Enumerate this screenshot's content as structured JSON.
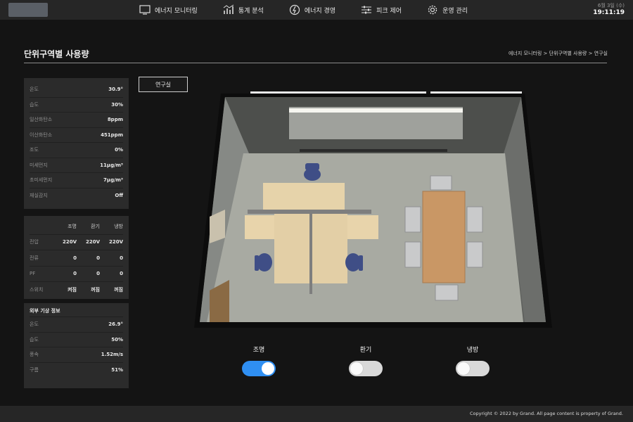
{
  "nav": {
    "items": [
      {
        "label": "에너지 모니터링",
        "icon": "monitor-icon"
      },
      {
        "label": "통계 분석",
        "icon": "chart-icon"
      },
      {
        "label": "에너지 경영",
        "icon": "energy-icon"
      },
      {
        "label": "피크 제어",
        "icon": "sliders-icon"
      },
      {
        "label": "운영 관리",
        "icon": "gear-icon"
      }
    ]
  },
  "clock": {
    "date": "6월 3일 (수)",
    "time": "19:11:19"
  },
  "page": {
    "title": "단위구역별 사용량",
    "breadcrumb": "에너지 모니터링 > 단위구역별 사용량 > 연구실"
  },
  "room_button": "연구실",
  "env": [
    {
      "key": "온도",
      "value": "30.9°"
    },
    {
      "key": "습도",
      "value": "30%"
    },
    {
      "key": "일산화탄소",
      "value": "8ppm"
    },
    {
      "key": "이산화탄소",
      "value": "451ppm"
    },
    {
      "key": "조도",
      "value": "0%"
    },
    {
      "key": "미세먼지",
      "value": "11μg/m³"
    },
    {
      "key": "초미세먼지",
      "value": "7μg/m³"
    },
    {
      "key": "재실감지",
      "value": "Off"
    }
  ],
  "power": {
    "headers": [
      "조명",
      "환기",
      "냉방"
    ],
    "rows": [
      {
        "key": "전압",
        "values": [
          "220V",
          "220V",
          "220V"
        ]
      },
      {
        "key": "전류",
        "values": [
          "0",
          "0",
          "0"
        ]
      },
      {
        "key": "PF",
        "values": [
          "0",
          "0",
          "0"
        ]
      },
      {
        "key": "스위치",
        "values": [
          "켜짐",
          "꺼짐",
          "꺼짐"
        ]
      }
    ]
  },
  "weather": {
    "title": "외부 기상 정보",
    "rows": [
      {
        "key": "온도",
        "value": "26.9°"
      },
      {
        "key": "습도",
        "value": "50%"
      },
      {
        "key": "풍속",
        "value": "1.52m/s"
      },
      {
        "key": "구름",
        "value": "51%"
      }
    ]
  },
  "controls": [
    {
      "label": "조명",
      "state": "on"
    },
    {
      "label": "환기",
      "state": "off"
    },
    {
      "label": "냉방",
      "state": "off"
    }
  ],
  "colors": {
    "accent": "#2f8ff2",
    "toggle_off": "#d9d9d9"
  },
  "footer": "Copyright © 2022 by Grand. All page content is property of Grand."
}
